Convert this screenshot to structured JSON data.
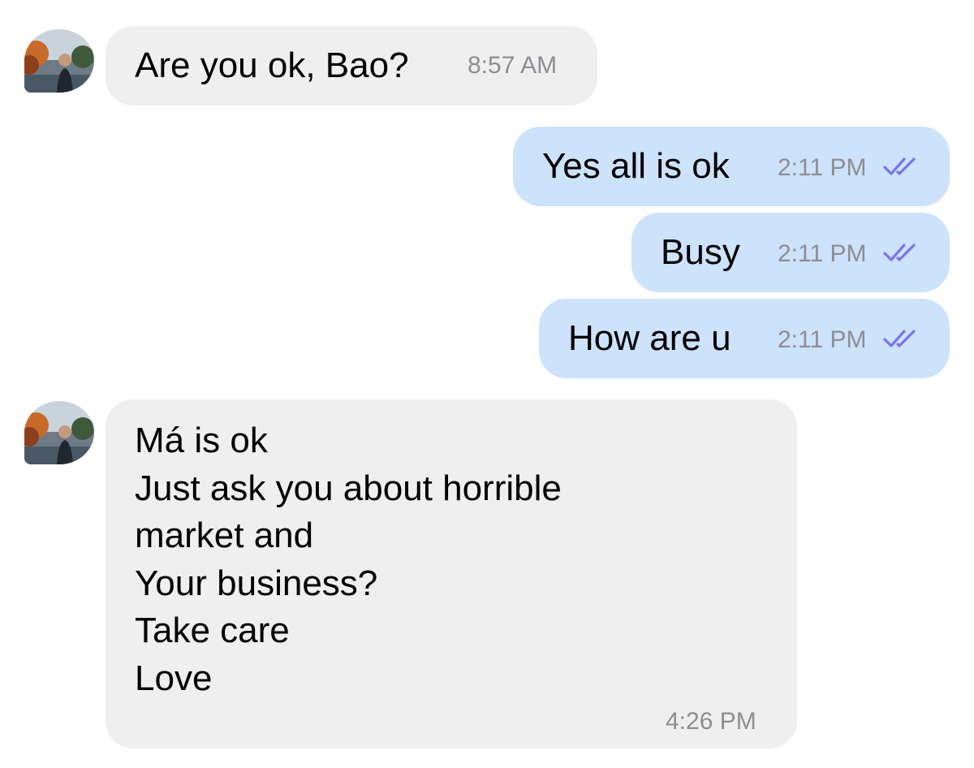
{
  "conversation": {
    "contact_avatar_icon": "contact-photo-avatar",
    "read_receipt_icon": "double-check-icon",
    "read_receipt_color": "#7b73e8",
    "incoming_bubble_color": "#efefef",
    "outgoing_bubble_color": "#cde2fb",
    "messages": [
      {
        "direction": "incoming",
        "text": "Are you ok, Bao?",
        "time": "8:57 AM"
      },
      {
        "direction": "outgoing",
        "text": "Yes all is ok",
        "time": "2:11 PM",
        "status": "read"
      },
      {
        "direction": "outgoing",
        "text": "Busy",
        "time": "2:11 PM",
        "status": "read"
      },
      {
        "direction": "outgoing",
        "text": "How are u",
        "time": "2:11 PM",
        "status": "read"
      },
      {
        "direction": "incoming",
        "lines": [
          "Má is ok",
          "Just ask you about horrible",
          "market and",
          "Your business?",
          "Take care",
          "Love"
        ],
        "time": "4:26 PM"
      }
    ]
  }
}
